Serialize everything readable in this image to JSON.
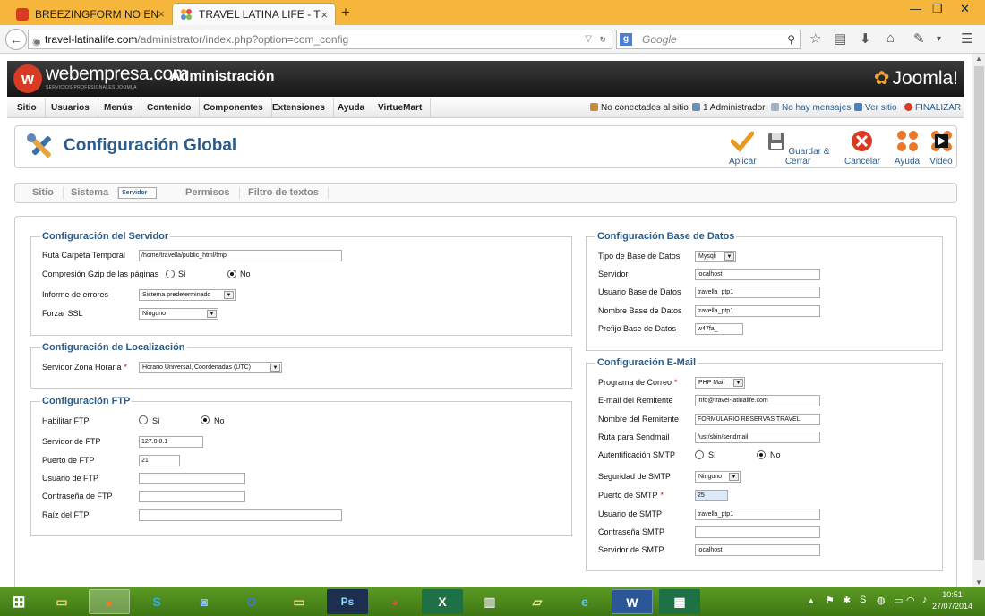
{
  "browser": {
    "tabs": [
      {
        "title": "BREEZINGFORM NO ENVIA...",
        "close": "×"
      },
      {
        "title": "TRAVEL LATINA LIFE - TO...",
        "close": "×"
      }
    ],
    "new_tab": "+",
    "window_controls": [
      "—",
      "❐",
      "✕"
    ],
    "url_host": "travel-latinalife.com",
    "url_path": "/administrator/index.php?option=com_config",
    "search_placeholder": "Google"
  },
  "header": {
    "logo_text": "webempresa.com",
    "logo_sub": "SERVICIOS PROFESIONALES JOOMLA",
    "title": "Administración",
    "joomla": "Joomla!"
  },
  "menu": {
    "items": [
      "Sitio",
      "Usuarios",
      "Menús",
      "Contenido",
      "Componentes",
      "Extensiones",
      "Ayuda",
      "VirtueMart"
    ],
    "status": [
      "No conectados al sitio",
      "1 Administrador",
      "No hay mensajes",
      "Ver sitio",
      "FINALIZAR"
    ]
  },
  "toolbar": {
    "title": "Configuración Global",
    "buttons": [
      "Aplicar",
      "Guardar & Cerrar",
      "Cancelar",
      "Ayuda",
      "Video"
    ]
  },
  "subtabs": [
    "Sitio",
    "Sistema",
    "Servidor",
    "Permisos",
    "Filtro de textos"
  ],
  "server": {
    "legend": "Configuración del Servidor",
    "tmp_label": "Ruta Carpeta Temporal",
    "tmp_value": "/home/travella/public_html/tmp",
    "gzip_label": "Compresión Gzip de las páginas",
    "yes": "Sí",
    "no": "No",
    "errors_label": "Informe de errores",
    "errors_value": "Sistema predeterminado",
    "ssl_label": "Forzar SSL",
    "ssl_value": "Ninguno"
  },
  "locale": {
    "legend": "Configuración de Localización",
    "tz_label": "Servidor Zona Horaria",
    "tz_value": "Horario Universal, Coordenadas (UTC)"
  },
  "ftp": {
    "legend": "Configuración FTP",
    "enable_label": "Habilitar FTP",
    "yes": "Sí",
    "no": "No",
    "server_label": "Servidor de FTP",
    "server_value": "127.0.0.1",
    "port_label": "Puerto de FTP",
    "port_value": "21",
    "user_label": "Usuario de FTP",
    "pass_label": "Contraseña de FTP",
    "root_label": "Raíz del FTP"
  },
  "database": {
    "legend": "Configuración Base de Datos",
    "type_label": "Tipo de Base de Datos",
    "type_value": "Mysqli",
    "server_label": "Servidor",
    "server_value": "localhost",
    "user_label": "Usuario Base de Datos",
    "user_value": "travella_ptp1",
    "name_label": "Nombre Base de Datos",
    "name_value": "travella_ptp1",
    "prefix_label": "Prefijo Base de Datos",
    "prefix_value": "w47fa_"
  },
  "email": {
    "legend": "Configuración E-Mail",
    "mailer_label": "Programa de Correo",
    "mailer_value": "PHP Mail",
    "from_label": "E-mail del Remitente",
    "from_value": "info@travel-latinalife.com",
    "fromname_label": "Nombre del Remitente",
    "fromname_value": "FORMULARIO RESERVAS TRAVEL",
    "sendmail_label": "Ruta para Sendmail",
    "sendmail_value": "/usr/sbin/sendmail",
    "smtpauth_label": "Autentificación SMTP",
    "yes": "Sí",
    "no": "No",
    "smtpsec_label": "Seguridad de SMTP",
    "smtpsec_value": "Ninguno",
    "smtpport_label": "Puerto de SMTP",
    "smtpport_value": "25",
    "smtpuser_label": "Usuario de SMTP",
    "smtpuser_value": "travella_ptp1",
    "smtppass_label": "Contraseña SMTP",
    "smtphost_label": "Servidor de SMTP",
    "smtphost_value": "localhost"
  },
  "taskbar": {
    "time": "10:51",
    "date": "27/07/2014"
  }
}
